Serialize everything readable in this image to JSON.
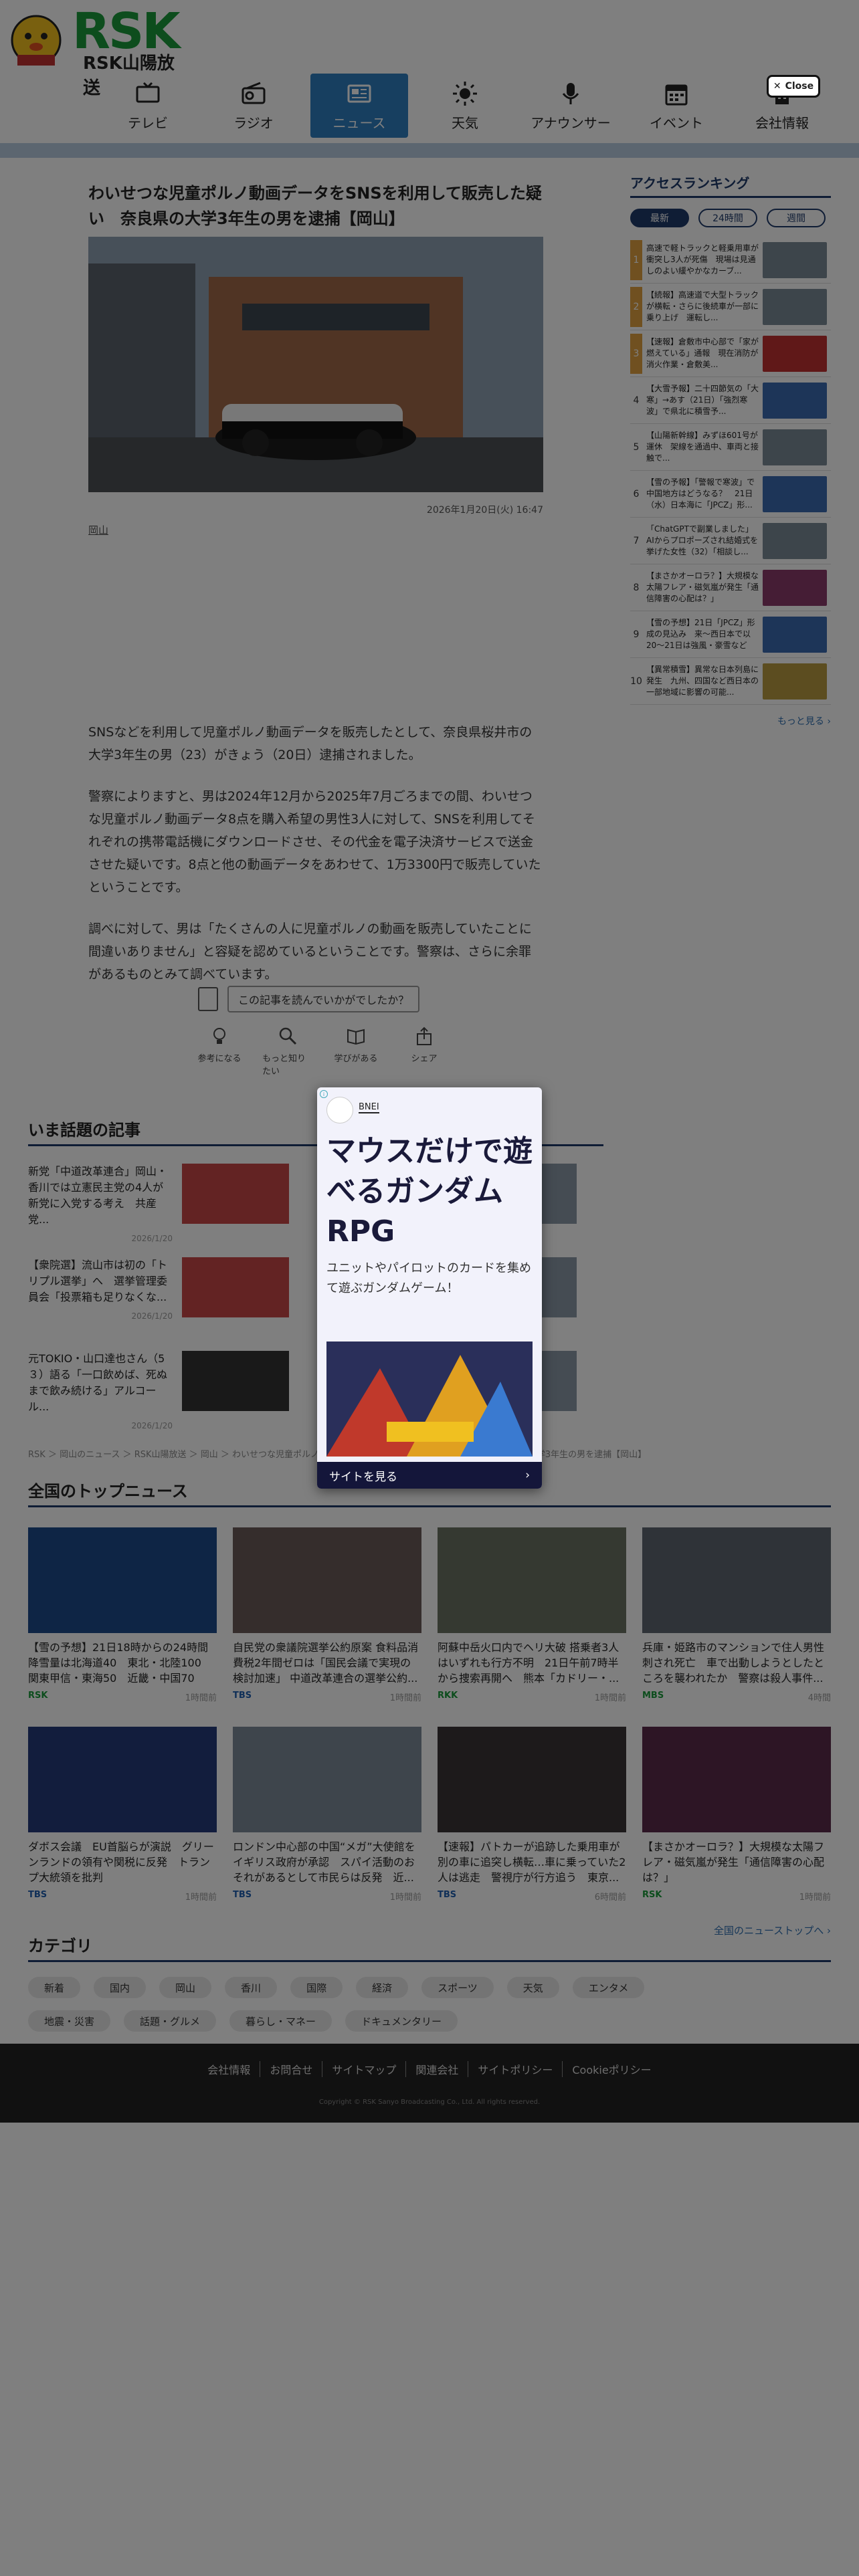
{
  "header": {
    "logo_text": "RSK",
    "logo_sub": "RSK山陽放送",
    "close_label": "Close",
    "nav": [
      {
        "label": "テレビ",
        "icon": "tv-icon"
      },
      {
        "label": "ラジオ",
        "icon": "radio-icon"
      },
      {
        "label": "ニュース",
        "icon": "news-icon",
        "active": true
      },
      {
        "label": "天気",
        "icon": "sun-icon"
      },
      {
        "label": "アナウンサー",
        "icon": "microphone-icon"
      },
      {
        "label": "イベント",
        "icon": "calendar-icon"
      },
      {
        "label": "会社情報",
        "icon": "building-icon"
      }
    ]
  },
  "article": {
    "title": "わいせつな児童ポルノ動画データをSNSを利用して販売した疑い　奈良県の大学3年生の男を逮捕【岡山】",
    "date": "2026年1月20日(火) 16:47",
    "tag": "岡山",
    "paragraphs": [
      "SNSなどを利用して児童ポルノ動画データを販売したとして、奈良県桜井市の大学3年生の男（23）がきょう（20日）逮捕されました。",
      "警察によりますと、男は2024年12月から2025年7月ごろまでの間、わいせつな児童ポルノ動画データ8点を購入希望の男性3人に対して、SNSを利用してそれぞれの携帯電話機にダウンロードさせ、その代金を電子決済サービスで送金させた疑いです。8点と他の動画データをあわせて、1万3300円で販売していたということです。",
      "調べに対して、男は「たくさんの人に児童ポルノの動画を販売していたことに間違いありません」と容疑を認めているということです。警察は、さらに余罪があるものとみて調べています。"
    ],
    "feedback_question": "この記事を読んでいかがでしたか？",
    "reactions": [
      {
        "label": "参考になる",
        "icon": "lightbulb-icon"
      },
      {
        "label": "もっと知りたい",
        "icon": "magnifier-icon"
      },
      {
        "label": "学びがある",
        "icon": "book-icon"
      },
      {
        "label": "シェア",
        "icon": "share-icon"
      }
    ]
  },
  "ranking": {
    "title": "アクセスランキング",
    "tabs": [
      "最新",
      "24時間",
      "週間"
    ],
    "active_tab": "最新",
    "items": [
      {
        "rank": "1",
        "text": "高速で軽トラックと軽乗用車が衝突し3人が死傷　現場は見通しのよい緩やかなカーブ..."
      },
      {
        "rank": "2",
        "text": "【続報】高速道で大型トラックが横転・さらに後続車が一部に乗り上げ　運転し..."
      },
      {
        "rank": "3",
        "text": "【速報】倉敷市中心部で「家が燃えている」通報　現在消防が消火作業・倉敷美..."
      },
      {
        "rank": "4",
        "text": "【大雪予報】二十四節気の「大寒」→あす（21日）「強烈寒波」で県北に積雪予..."
      },
      {
        "rank": "5",
        "text": "【山陽新幹線】みずほ601号が運休　架線を通過中、車両と接触で..."
      },
      {
        "rank": "6",
        "text": "【雪の予報】「警報で寒波」で中国地方はどうなる？　21日（水）日本海に「JPCZ」形..."
      },
      {
        "rank": "7",
        "text": "「ChatGPTで副業しました」AIからプロポーズされ結婚式を挙げた女性（32）「相談し..."
      },
      {
        "rank": "8",
        "text": "【まさかオーロラ？】大規模な太陽フレア・磁気嵐が発生「通信障害の心配は？」"
      },
      {
        "rank": "9",
        "text": "【雪の予想】21日「JPCZ」形成の見込み　来〜西日本で以20〜21日は強風・豪雪などの..."
      },
      {
        "rank": "10",
        "text": "【異常積雪】異常な日本列島に発生　九州、四国など西日本の一部地域に影響の可能..."
      }
    ],
    "more_label": "もっと見る ›"
  },
  "hot": {
    "title": "いま話題の記事",
    "items": [
      {
        "text": "新党「中道改革連合」岡山・香川では立憲民主党の4人が新党に入党する考え　共産党...",
        "date": "2026/1/20"
      },
      {
        "text": "【衆院選】流山市は初の「トリプル選挙」へ　選挙管理委員会「投票箱も足りなくな...",
        "date": "2026/1/20"
      },
      {
        "text": "元TOKIO・山口達也さん（5３）語る「一口飲めば、死ぬまで飲み続ける」アルコール...",
        "date": "2026/1/20"
      }
    ],
    "breadcrumb": "RSK ＞ 岡山のニュース ＞ RSK山陽放送 ＞ 岡山 ＞ わいせつな児童ポルノ動画データをSNSを利用して販売した疑い　奈良県の大学3年生の男を逮捕【岡山】"
  },
  "topnews": {
    "title": "全国のトップニュース",
    "items": [
      {
        "title": "【雪の予想】21日18時からの24時間降雪量は北海道40　東北・北陸100　関東甲信・東海50　近畿・中国70（c...",
        "src": "RSK",
        "time": "1時間前",
        "src_color": "#1a9a3a"
      },
      {
        "title": "自民党の衆議院選挙公約原案 食料品消費税2年間ゼロは「国民会議で実現の検討加速」 中道改革連合の選挙公約...",
        "src": "TBS",
        "time": "1時間前",
        "src_color": "#1f5fb0"
      },
      {
        "title": "阿蘇中岳火口内でヘリ大破 搭乗者3人はいずれも行方不明　21日午前7時半から捜索再開へ　熊本「カドリー・...",
        "src": "RKK",
        "time": "1時間前",
        "src_color": "#1a9a3a"
      },
      {
        "title": "兵庫・姫路市のマンションで住人男性刺され死亡　車で出動しようとしたところを襲われたか　警察は殺人事件...",
        "src": "MBS",
        "time": "4時間",
        "src_color": "#1a9a3a"
      },
      {
        "title": "ダボス会議　EU首脳らが演説　グリーンランドの領有や関税に反発　トランプ大統領を批判",
        "src": "TBS",
        "time": "1時間前",
        "src_color": "#1f5fb0"
      },
      {
        "title": "ロンドン中心部の中国“メガ”大使館をイギリス政府が承認　スパイ活動のおそれがあるとして市民らは反発　近...",
        "src": "TBS",
        "time": "1時間前",
        "src_color": "#1f5fb0"
      },
      {
        "title": "【速報】パトカーが追跡した乗用車が別の車に追突し横転…車に乗っていた2人は逃走　警視庁が行方追う　東京...",
        "src": "TBS",
        "time": "6時間前",
        "src_color": "#1f5fb0"
      },
      {
        "title": "【まさかオーロラ？】大規模な太陽フレア・磁気嵐が発生「通信障害の心配は？」",
        "src": "RSK",
        "time": "1時間前",
        "src_color": "#1a9a3a"
      }
    ],
    "more_label": "全国のニューストップへ ›"
  },
  "categories": {
    "title": "カテゴリ",
    "items": [
      "新着",
      "国内",
      "岡山",
      "香川",
      "国際",
      "経済",
      "スポーツ",
      "天気",
      "エンタメ",
      "地震・災害",
      "話題・グルメ",
      "暮らし・マネー",
      "ドキュメンタリー"
    ]
  },
  "footer": {
    "links": [
      "会社情報",
      "お問合せ",
      "サイトマップ",
      "関連会社",
      "サイトポリシー",
      "Cookieポリシー"
    ],
    "copyright": "Copyright © RSK Sanyo Broadcasting Co., Ltd. All rights reserved."
  },
  "ad": {
    "brand": "BNEI",
    "headline": "マウスだけで遊べるガンダムRPG",
    "sub": "ユニットやパイロットのカードを集めて遊ぶガンダムゲーム！",
    "cta": "サイトを見る"
  }
}
